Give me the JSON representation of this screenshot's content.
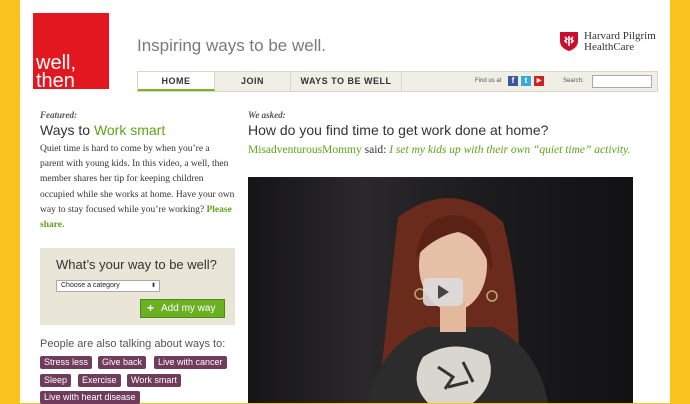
{
  "header": {
    "logo_line1": "well,",
    "logo_line2": "then",
    "tagline": "Inspiring ways to be well.",
    "partner_line1": "Harvard Pilgrim",
    "partner_line2": "HealthCare"
  },
  "nav": {
    "tabs": [
      "HOME",
      "JOIN",
      "WAYS TO BE WELL"
    ],
    "active_tab": "HOME",
    "find_us": "Find us at",
    "social": [
      {
        "icon": "facebook-icon",
        "glyph": "f",
        "color": "#3b5998"
      },
      {
        "icon": "twitter-icon",
        "glyph": "t",
        "color": "#33aadd"
      },
      {
        "icon": "youtube-icon",
        "glyph": "▶",
        "color": "#cc2222"
      }
    ],
    "search_label": "Search:",
    "search_value": ""
  },
  "featured": {
    "label": "Featured:",
    "title_prefix": "Ways to ",
    "title_highlight": "Work smart",
    "body": "Quiet time is hard to come by when you’re a parent with young kids. In this video, a well, then member shares her tip for keeping children occupied while she works at home. Have your own way to stay focused while you’re working?",
    "share_link": "Please share."
  },
  "way_box": {
    "question": "What’s your way to be well?",
    "select_value": "Choose a category",
    "button_label": "Add my way"
  },
  "talking": {
    "label": "People are also talking about ways to:",
    "tags": [
      "Stress less",
      "Give back",
      "Live with cancer",
      "Sleep",
      "Exercise",
      "Work smart",
      "Live with heart disease"
    ]
  },
  "asked": {
    "label": "We asked:",
    "question": "How do you find time to get work done at home?",
    "user": "MisadventurousMommy",
    "said": " said: ",
    "answer": "I set my kids up with their own “quiet time” activity."
  },
  "colors": {
    "accent_green": "#5fa31a",
    "brand_red": "#e3171f",
    "tag_purple": "#6f3c5c",
    "frame_yellow": "#f9c21d"
  }
}
